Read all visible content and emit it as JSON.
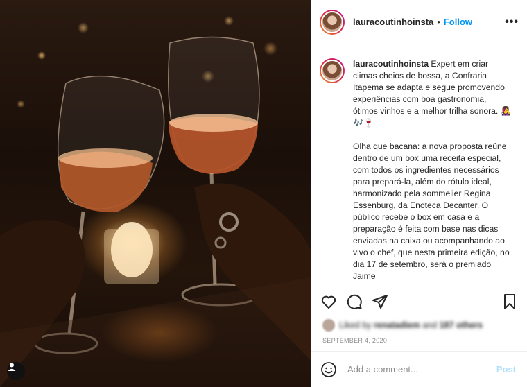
{
  "post": {
    "username": "lauracoutinhoinsta",
    "follow_label": "Follow",
    "dot": "•",
    "more_label": "•••",
    "caption_username": "lauracoutinhoinsta",
    "caption_p1": "Expert em criar climas cheios de bossa, a Confraria Itapema se adapta e segue promovendo experiências com boa gastronomia, ótimos vinhos e a melhor trilha sonora. 👩‍🎤🎶🍷",
    "caption_p2": "Olha que bacana: a nova proposta reúne dentro de um box uma receita especial, com todos os ingredientes necessários para prepará-la, além do rótulo ideal, harmonizado pela sommelier Regina Essenburg, da Enoteca Decanter. O público recebe o box em casa e a preparação é feita com base nas dicas enviadas na caixa ou acompanhando ao vivo o chef, que nesta primeira edição, no dia 17 de setembro, será o premiado Jaime",
    "likes_prefix": "Liked by",
    "likes_user": "renatadiem",
    "likes_and": "and",
    "likes_others": "187 others",
    "date": "SEPTEMBER 4, 2020"
  },
  "comment": {
    "placeholder": "Add a comment...",
    "post_label": "Post"
  },
  "colors": {
    "accent": "#0095f6",
    "post_disabled": "#b2dffc",
    "muted": "#8e8e8e"
  },
  "icons": {
    "like": "heart-icon",
    "comment": "comment-icon",
    "share": "paper-plane-icon",
    "save": "bookmark-icon",
    "emoji": "emoji-icon",
    "user_tag": "user-icon",
    "more": "more-options-icon"
  }
}
